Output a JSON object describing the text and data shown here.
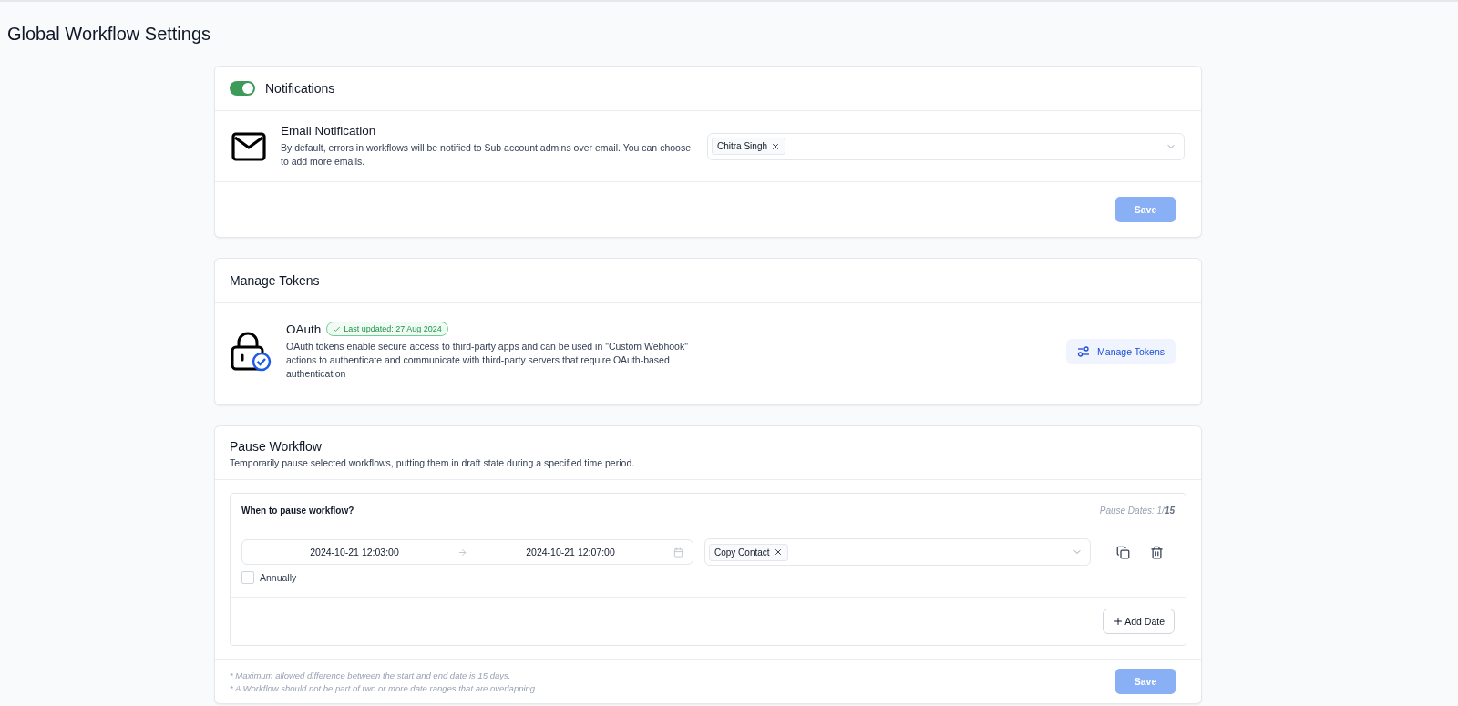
{
  "page_title": "Global Workflow Settings",
  "notifications": {
    "toggle": {
      "label": "Notifications",
      "on": true
    },
    "email": {
      "title": "Email Notification",
      "description": "By default, errors in workflows will be notified to Sub account admins over email. You can choose to add more emails.",
      "tags": [
        "Chitra Singh"
      ]
    },
    "save_button": {
      "label": "Save",
      "disabled": true
    }
  },
  "tokens": {
    "title": "Manage Tokens",
    "oauth": {
      "title": "OAuth",
      "badge": "Last updated: 27 Aug 2024",
      "description": "OAuth tokens enable secure access to third-party apps and can be used in \"Custom Webhook\" actions to authenticate and communicate with third-party servers that require OAuth-based authentication"
    },
    "button": "Manage Tokens"
  },
  "pause": {
    "title": "Pause Workflow",
    "subtitle": "Temporarily pause selected workflows, putting them in draft state during a specified time period.",
    "panel_title": "When to pause workflow?",
    "counter": "Pause Dates: 1/**15**",
    "ranges": [
      {
        "start": "2024-10-21 12:03:00",
        "end": "2024-10-21 12:07:00",
        "workflows": [
          "Copy Contact"
        ],
        "annually": {
          "label": "Annually",
          "checked": false
        }
      }
    ],
    "add_button": "Add Date",
    "notes": [
      "* Maximum allowed difference between the start and end date is 15 days.",
      "* A Workflow should not be part of two or more date ranges that are overlapping."
    ],
    "save_button": {
      "label": "Save",
      "disabled": true
    }
  }
}
